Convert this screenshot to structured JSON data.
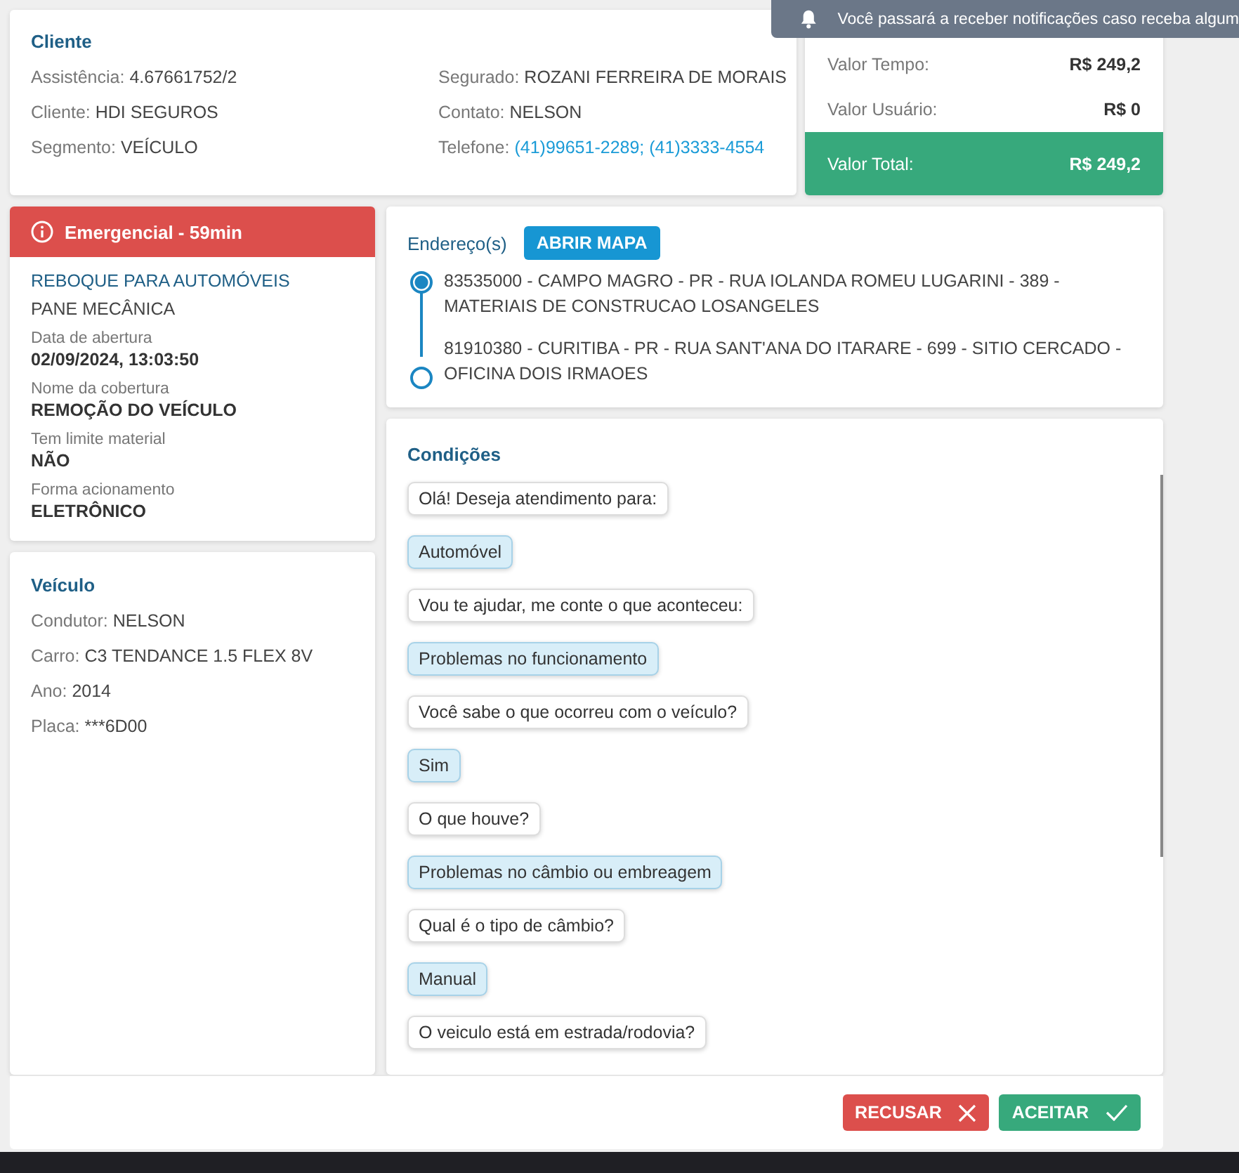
{
  "notification": {
    "text": "Você passará a receber notificações caso receba algum"
  },
  "client": {
    "title": "Cliente",
    "left": [
      {
        "label": "Assistência:",
        "value": "4.67661752/2",
        "kind": "plain"
      },
      {
        "label": "Cliente:",
        "value": "HDI SEGUROS",
        "kind": "plain"
      },
      {
        "label": "Segmento:",
        "value": "VEÍCULO",
        "kind": "plain"
      }
    ],
    "right": [
      {
        "label": "Segurado:",
        "value": "ROZANI FERREIRA DE MORAIS",
        "kind": "plain"
      },
      {
        "label": "Contato:",
        "value": "NELSON",
        "kind": "plain"
      },
      {
        "label": "Telefone:",
        "value": "(41)99651-2289; (41)3333-4554",
        "kind": "link"
      }
    ]
  },
  "values": {
    "rows": [
      {
        "label": "Valor Tempo:",
        "value": "R$ 249,2"
      },
      {
        "label": "Valor Usuário:",
        "value": "R$ 0"
      }
    ],
    "total": {
      "label": "Valor Total:",
      "value": "R$ 249,2"
    }
  },
  "service": {
    "alert": "Emergencial - 59min",
    "title": "REBOQUE PARA AUTOMÓVEIS",
    "subtitle": "PANE MECÂNICA",
    "details": [
      {
        "label": "Data de abertura",
        "value": "02/09/2024, 13:03:50"
      },
      {
        "label": "Nome da cobertura",
        "value": "REMOÇÃO DO VEÍCULO"
      },
      {
        "label": "Tem limite material",
        "value": "NÃO"
      },
      {
        "label": "Forma acionamento",
        "value": "ELETRÔNICO"
      }
    ]
  },
  "vehicle": {
    "title": "Veículo",
    "fields": [
      {
        "label": "Condutor:",
        "value": "NELSON"
      },
      {
        "label": "Carro:",
        "value": "C3 TENDANCE 1.5 FLEX 8V"
      },
      {
        "label": "Ano:",
        "value": "2014"
      },
      {
        "label": "Placa:",
        "value": "***6D00"
      }
    ]
  },
  "addresses": {
    "title": "Endereço(s)",
    "button": "ABRIR MAPA",
    "items": [
      {
        "text": "83535000 - CAMPO MAGRO - PR - RUA IOLANDA ROMEU LUGARINI - 389 - MATERIAIS DE CONSTRUCAO LOSANGELES",
        "selected": true
      },
      {
        "text": "81910380 - CURITIBA - PR - RUA SANT'ANA DO ITARARE - 699 - SITIO CERCADO - OFICINA DOIS IRMAOES",
        "selected": false
      }
    ]
  },
  "conditions": {
    "title": "Condições",
    "messages": [
      {
        "kind": "question",
        "text": "Olá! Deseja atendimento para:"
      },
      {
        "kind": "answer",
        "text": "Automóvel"
      },
      {
        "kind": "question",
        "text": "Vou te ajudar, me conte o que aconteceu:"
      },
      {
        "kind": "answer",
        "text": "Problemas no funcionamento"
      },
      {
        "kind": "question",
        "text": "Você sabe o que ocorreu com o veículo?"
      },
      {
        "kind": "answer",
        "text": "Sim"
      },
      {
        "kind": "question",
        "text": "O que houve?"
      },
      {
        "kind": "answer",
        "text": "Problemas no câmbio ou embreagem"
      },
      {
        "kind": "question",
        "text": "Qual é o tipo de câmbio?"
      },
      {
        "kind": "answer",
        "text": "Manual"
      },
      {
        "kind": "question",
        "text": "O veiculo está em estrada/rodovia?"
      }
    ]
  },
  "actions": [
    {
      "kind": "reject",
      "label": "RECUSAR"
    },
    {
      "kind": "accept",
      "label": "ACEITAR"
    }
  ]
}
